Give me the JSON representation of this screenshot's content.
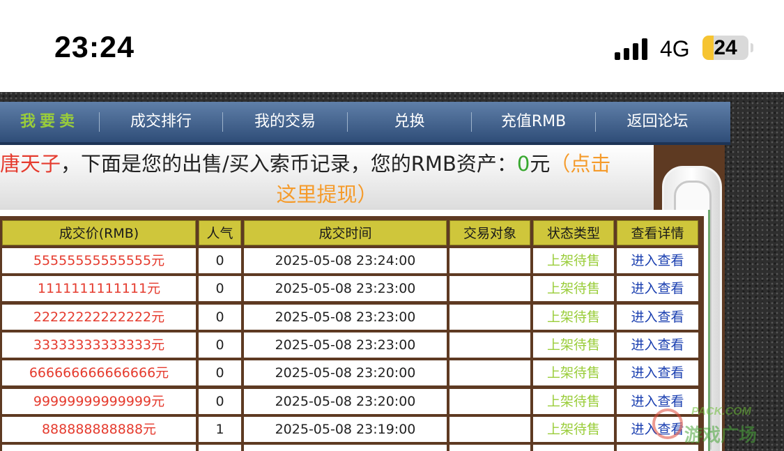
{
  "status_bar": {
    "time": "23:24",
    "network": "4G",
    "battery": "24",
    "battery_level": 0.24
  },
  "nav": {
    "items": [
      "我要卖",
      "成交排行",
      "我的交易",
      "兑换",
      "充值RMB",
      "返回论坛"
    ]
  },
  "banner": {
    "name": "唐天子",
    "text_mid": "，下面是您的出售/买入索币记录，您的RMB资产：",
    "rmb_value": "0",
    "unit": "元",
    "withdraw_a": "（点击",
    "withdraw_b": "这里提现）"
  },
  "table": {
    "headers": [
      "成交价(RMB)",
      "人气",
      "成交时间",
      "交易对象",
      "状态类型",
      "查看详情"
    ],
    "rows": [
      {
        "price": "55555555555555元",
        "views": "0",
        "time": "2025-05-08 23:24:00",
        "partner": "",
        "status": "上架待售",
        "detail": "进入查看"
      },
      {
        "price": "1111111111111元",
        "views": "0",
        "time": "2025-05-08 23:23:00",
        "partner": "",
        "status": "上架待售",
        "detail": "进入查看"
      },
      {
        "price": "22222222222222元",
        "views": "0",
        "time": "2025-05-08 23:23:00",
        "partner": "",
        "status": "上架待售",
        "detail": "进入查看"
      },
      {
        "price": "33333333333333元",
        "views": "0",
        "time": "2025-05-08 23:23:00",
        "partner": "",
        "status": "上架待售",
        "detail": "进入查看"
      },
      {
        "price": "666666666666666元",
        "views": "0",
        "time": "2025-05-08 23:20:00",
        "partner": "",
        "status": "上架待售",
        "detail": "进入查看"
      },
      {
        "price": "99999999999999元",
        "views": "0",
        "time": "2025-05-08 23:20:00",
        "partner": "",
        "status": "上架待售",
        "detail": "进入查看"
      },
      {
        "price": "888888888888元",
        "views": "1",
        "time": "2025-05-08 23:19:00",
        "partner": "",
        "status": "上架待售",
        "detail": "进入查看"
      }
    ]
  },
  "watermark": {
    "line1": "PACK.COM",
    "line2": "游戏广场"
  },
  "colors": {
    "nav_bg": "#3d5d88",
    "active_nav": "#9acd3a",
    "header_bg": "#cfc63b",
    "price": "#e53b2e",
    "status": "#9acd3a",
    "link": "#1a3fb0",
    "withdraw": "#f59b2b"
  }
}
